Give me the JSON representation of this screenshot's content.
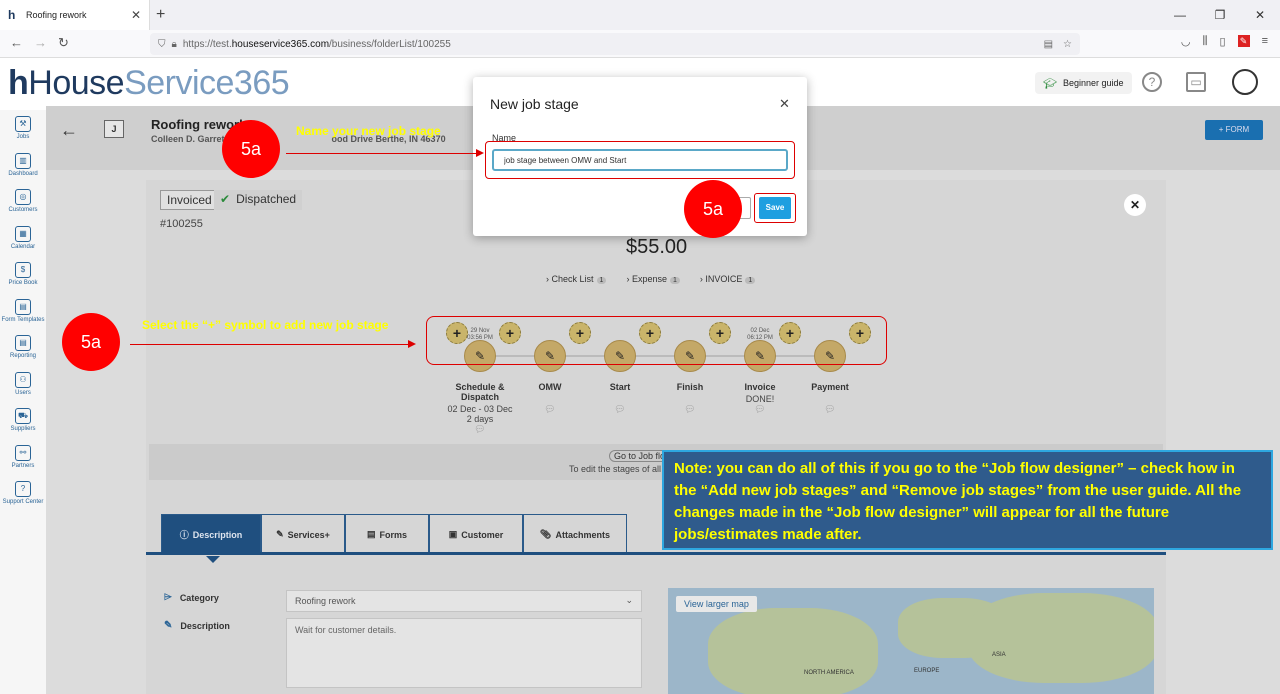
{
  "browser": {
    "tab_title": "Roofing rework",
    "url_prefix": "https://test.",
    "url_domain": "houseservice365.com",
    "url_path": "/business/folderList/100255"
  },
  "header": {
    "logo_house": "House",
    "logo_service": "Service365",
    "beginner_guide": "Beginner guide"
  },
  "sidebar": {
    "items": [
      {
        "label": "Jobs",
        "icon": "tools-icon"
      },
      {
        "label": "Dashboard",
        "icon": "chart-icon"
      },
      {
        "label": "Customers",
        "icon": "customers-icon"
      },
      {
        "label": "Calendar",
        "icon": "calendar-icon"
      },
      {
        "label": "Price Book",
        "icon": "pricebook-icon"
      },
      {
        "label": "Form Templates",
        "icon": "form-icon"
      },
      {
        "label": "Reporting",
        "icon": "report-icon"
      },
      {
        "label": "Users",
        "icon": "users-icon"
      },
      {
        "label": "Suppliers",
        "icon": "truck-icon"
      },
      {
        "label": "Partners",
        "icon": "partners-icon"
      },
      {
        "label": "Support Center",
        "icon": "support-icon"
      }
    ]
  },
  "job": {
    "badge": "J",
    "title": "Roofing rework",
    "subtitle": "Colleen D. Garrett",
    "address_fragment": "ood Drive Berthe, IN 46370",
    "form_button": "+ FORM",
    "status_invoiced": "Invoiced",
    "status_dispatched": "Dispatched",
    "number": "#100255",
    "price": "$55.00",
    "links": [
      {
        "label": "Check List",
        "count": "1"
      },
      {
        "label": "Expense",
        "count": "1"
      },
      {
        "label": "INVOICE",
        "count": "1"
      }
    ],
    "stages": [
      {
        "label": "Schedule & Dispatch",
        "date": "29 Nov",
        "time": "03:56 PM",
        "sub": "02 Dec - 03 Dec",
        "sub2": "2 days"
      },
      {
        "label": "OMW",
        "date": "",
        "time": "",
        "sub": "",
        "sub2": ""
      },
      {
        "label": "Start",
        "date": "",
        "time": "",
        "sub": "",
        "sub2": ""
      },
      {
        "label": "Finish",
        "date": "",
        "time": "",
        "sub": "",
        "sub2": ""
      },
      {
        "label": "Invoice",
        "date": "02 Dec",
        "time": "06:12 PM",
        "sub": "DONE!",
        "sub2": ""
      },
      {
        "label": "Payment",
        "date": "",
        "time": "",
        "sub": "",
        "sub2": ""
      }
    ],
    "flow_link": "Go to Job flow designer",
    "flow_hint": "To edit the stages of all n"
  },
  "tabs": [
    {
      "label": "Description",
      "icon": "info-icon"
    },
    {
      "label": "Services+",
      "icon": "wrench-icon"
    },
    {
      "label": "Forms",
      "icon": "document-icon"
    },
    {
      "label": "Customer",
      "icon": "id-card-icon"
    },
    {
      "label": "Attachments",
      "icon": "paperclip-icon"
    }
  ],
  "details": {
    "category_label": "Category",
    "category_value": "Roofing rework",
    "description_label": "Description",
    "description_value": "Wait for customer details.",
    "map_button": "View larger map",
    "map_labels": [
      "NORTH AMERICA",
      "EUROPE",
      "ASIA"
    ]
  },
  "modal": {
    "title": "New job stage",
    "name_label": "Name",
    "name_value": "job stage between OMW and Start",
    "save": "Save"
  },
  "annotations": {
    "badge": "5a",
    "name_hint": "Name your new job stage",
    "plus_hint": "Select the “+” symbol to add new job stage",
    "note": "Note: you can do all of this if you go to the “Job flow designer” – check how in the “Add new job stages” and “Remove job stages” from the user guide. All the changes made in the “Job flow designer” will appear for all the future jobs/estimates made after."
  }
}
